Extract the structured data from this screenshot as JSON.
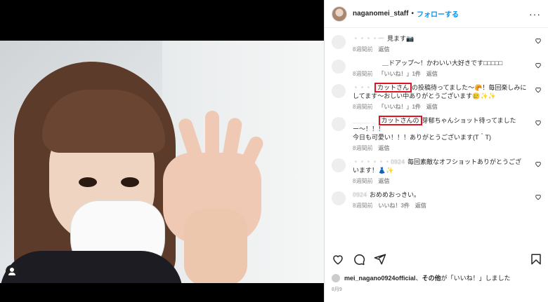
{
  "post": {
    "username": "naganomei_staff",
    "separator": "•",
    "follow_label": "フォローする",
    "more_label": "···"
  },
  "comments": [
    {
      "user": "・・・・ー",
      "text": "見ます📷",
      "time": "8週間前",
      "likes": "",
      "reply": "返信"
    },
    {
      "user": "",
      "text": "＿ドアップ〜！かわいい大好きです□□□□□",
      "time": "8週間前",
      "likes": "「いいね！」1件",
      "reply": "返信"
    },
    {
      "user": "・・・",
      "highlight": "カットさん",
      "text_after": "の投稿待ってました〜🥐！毎回楽しみにしてます〜おしい中ありがとうございます🥲✨✨",
      "time": "8週間前",
      "likes": "「いいね！」1件",
      "reply": "返信"
    },
    {
      "user": "_____ _",
      "highlight": "カットさんの",
      "text_after": "芽郁ちゃんショット待ってましたー〜！！！\n今日も可愛い！！！ありがとうございます(T＾T)",
      "time": "8週間前",
      "likes": "",
      "reply": "返信"
    },
    {
      "user": "・・・・・・0924",
      "text": "毎回素敵なオフショットありがとうございます！👗✨",
      "time": "8週間前",
      "likes": "",
      "reply": "返信"
    },
    {
      "user": "0924",
      "text": "おめめおっきい。",
      "time": "8週間前",
      "likes": "いいね！3件",
      "reply": "返信"
    }
  ],
  "likes_line": {
    "user": "mei_nagano0924official",
    "middle": "、",
    "others": "その他",
    "suffix": "が「いいね！」しました"
  },
  "date": "8月9",
  "icons": {
    "heart": "heart-icon",
    "comment": "comment-icon",
    "share": "share-icon",
    "save": "bookmark-icon"
  }
}
